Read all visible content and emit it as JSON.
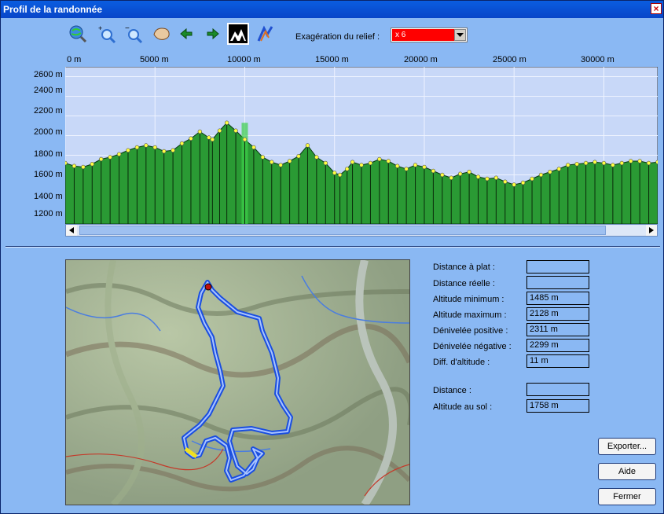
{
  "window": {
    "title": "Profil de la randonnée"
  },
  "toolbar": {
    "tools": [
      {
        "icon": "globe-zoom-icon"
      },
      {
        "icon": "zoom-in-icon"
      },
      {
        "icon": "zoom-out-icon"
      },
      {
        "icon": "pan-hand-icon"
      },
      {
        "icon": "arrow-left-icon"
      },
      {
        "icon": "arrow-right-icon"
      },
      {
        "icon": "relief-view-icon",
        "active": true
      },
      {
        "icon": "route-profile-icon"
      }
    ],
    "exaggeration_label": "Exagération du relief :",
    "exaggeration_value": "x 6"
  },
  "profile": {
    "x_labels": [
      "0 m",
      "5000 m",
      "10000 m",
      "15000 m",
      "20000 m",
      "25000 m",
      "30000 m"
    ],
    "y_labels": [
      "2600 m",
      "2400 m",
      "2200 m",
      "2000 m",
      "1800 m",
      "1600 m",
      "1400 m",
      "1200 m"
    ]
  },
  "chart_data": {
    "type": "area",
    "xlabel": "",
    "ylabel": "",
    "xlim": [
      0,
      33000
    ],
    "ylim": [
      1100,
      2700
    ],
    "ticks_x": [
      0,
      5000,
      10000,
      15000,
      20000,
      25000,
      30000
    ],
    "ticks_y": [
      1200,
      1400,
      1600,
      1800,
      2000,
      2200,
      2400,
      2600
    ],
    "grid": true,
    "series": [
      {
        "x": [
          0,
          500,
          1000,
          1500,
          2000,
          2500,
          3000,
          3500,
          4000,
          4500,
          5000,
          5500,
          6000,
          6500,
          7000,
          7500,
          8000,
          8200,
          8600,
          9000,
          9500,
          10000,
          10500,
          11000,
          11500,
          12000,
          12500,
          13000,
          13500,
          14000,
          14500,
          15000,
          15300,
          15700,
          16000,
          16500,
          17000,
          17500,
          18000,
          18500,
          19000,
          19500,
          20000,
          20500,
          21000,
          21500,
          22000,
          22500,
          23000,
          23500,
          24000,
          24500,
          25000,
          25500,
          26000,
          26500,
          27000,
          27500,
          28000,
          28500,
          29000,
          29500,
          30000,
          30500,
          31000,
          31500,
          32000,
          32500,
          33000
        ],
        "values": [
          1720,
          1690,
          1680,
          1710,
          1760,
          1780,
          1810,
          1850,
          1880,
          1900,
          1880,
          1840,
          1850,
          1920,
          1970,
          2040,
          1980,
          1960,
          2050,
          2130,
          2050,
          1960,
          1880,
          1780,
          1730,
          1700,
          1740,
          1790,
          1900,
          1780,
          1720,
          1620,
          1600,
          1660,
          1730,
          1700,
          1720,
          1760,
          1740,
          1690,
          1660,
          1700,
          1680,
          1640,
          1600,
          1570,
          1610,
          1630,
          1580,
          1560,
          1570,
          1530,
          1500,
          1520,
          1560,
          1600,
          1630,
          1660,
          1700,
          1710,
          1720,
          1730,
          1720,
          1700,
          1720,
          1740,
          1740,
          1720,
          1730
        ]
      }
    ]
  },
  "stats": {
    "rows": [
      {
        "label": "Distance à plat :",
        "value": ""
      },
      {
        "label": "Distance réelle :",
        "value": ""
      },
      {
        "label": "Altitude minimum :",
        "value": "1485 m"
      },
      {
        "label": "Altitude maximum :",
        "value": "2128 m"
      },
      {
        "label": "Dénivelée positive :",
        "value": "2311 m"
      },
      {
        "label": "Dénivelée négative :",
        "value": "2299 m"
      },
      {
        "label": "Diff. d'altitude :",
        "value": "11 m"
      }
    ],
    "cursor": [
      {
        "label": "Distance :",
        "value": ""
      },
      {
        "label": "Altitude au sol :",
        "value": "1758 m"
      }
    ]
  },
  "buttons": {
    "export": "Exporter...",
    "help": "Aide",
    "close": "Fermer"
  },
  "colors": {
    "window_bg": "#8ab8f3",
    "profile_fill": "#2a9a34",
    "profile_bg": "#c8d8f8",
    "route": "#1a4ee0"
  }
}
